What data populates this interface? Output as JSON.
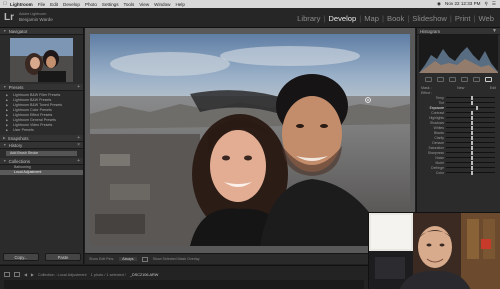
{
  "menubar": {
    "app": "Lightroom",
    "items": [
      "File",
      "Edit",
      "Develop",
      "Photo",
      "Settings",
      "Tools",
      "View",
      "Window",
      "Help"
    ],
    "clock": "Nov 22 12:33 PM"
  },
  "identity": {
    "small": "Adobe Lightroom",
    "name": "Benjamin Warde",
    "logo": "Lr"
  },
  "modules": [
    "Library",
    "Develop",
    "Map",
    "Book",
    "Slideshow",
    "Print",
    "Web"
  ],
  "left_panel": {
    "navigator": "Navigator",
    "presets": "Presets",
    "preset_items": [
      "Lightroom B&W Filter Presets",
      "Lightroom B&W Presets",
      "Lightroom B&W Toned Presets",
      "Lightroom Color Presets",
      "Lightroom Effect Presets",
      "Lightroom General Presets",
      "Lightroom Video Presets",
      "User Presets"
    ],
    "snapshots": "Snapshots",
    "history": "History",
    "history_item": "Add Brush Stroke",
    "collections": "Collections",
    "collection_items": [
      "Ballooning",
      "Local Adjustment"
    ],
    "copy_btn": "Copy...",
    "paste_btn": "Paste"
  },
  "toolbar": {
    "show_edit_pins": "Show Edit Pins:",
    "pins_value": "Always",
    "show_mask": "Show Selected Mask Overlay"
  },
  "right_panel": {
    "histogram": "Histogram",
    "mask_label": "Mask :",
    "mask_new": "New",
    "mask_edit": "Edit",
    "effect_label": "Effect :",
    "sliders": [
      {
        "name": "Temp",
        "value": 0.5
      },
      {
        "name": "Tint",
        "value": 0.5
      },
      {
        "name": "Exposure",
        "value": 0.62
      },
      {
        "name": "Contrast",
        "value": 0.5
      },
      {
        "name": "Highlights",
        "value": 0.5
      },
      {
        "name": "Shadows",
        "value": 0.5
      },
      {
        "name": "Whites",
        "value": 0.5
      },
      {
        "name": "Blacks",
        "value": 0.5
      },
      {
        "name": "Clarity",
        "value": 0.5
      },
      {
        "name": "Dehaze",
        "value": 0.5
      },
      {
        "name": "Saturation",
        "value": 0.5
      },
      {
        "name": "Sharpness",
        "value": 0.5
      },
      {
        "name": "Noise",
        "value": 0.5
      },
      {
        "name": "Moiré",
        "value": 0.5
      },
      {
        "name": "Defringe",
        "value": 0.5
      },
      {
        "name": "Color",
        "value": 0.5
      }
    ]
  },
  "filmstrip": {
    "collection": "Collection : Local Adjustment",
    "counts": "1 photo / 1 selected /",
    "filename": "_DSC2106.ARW"
  }
}
